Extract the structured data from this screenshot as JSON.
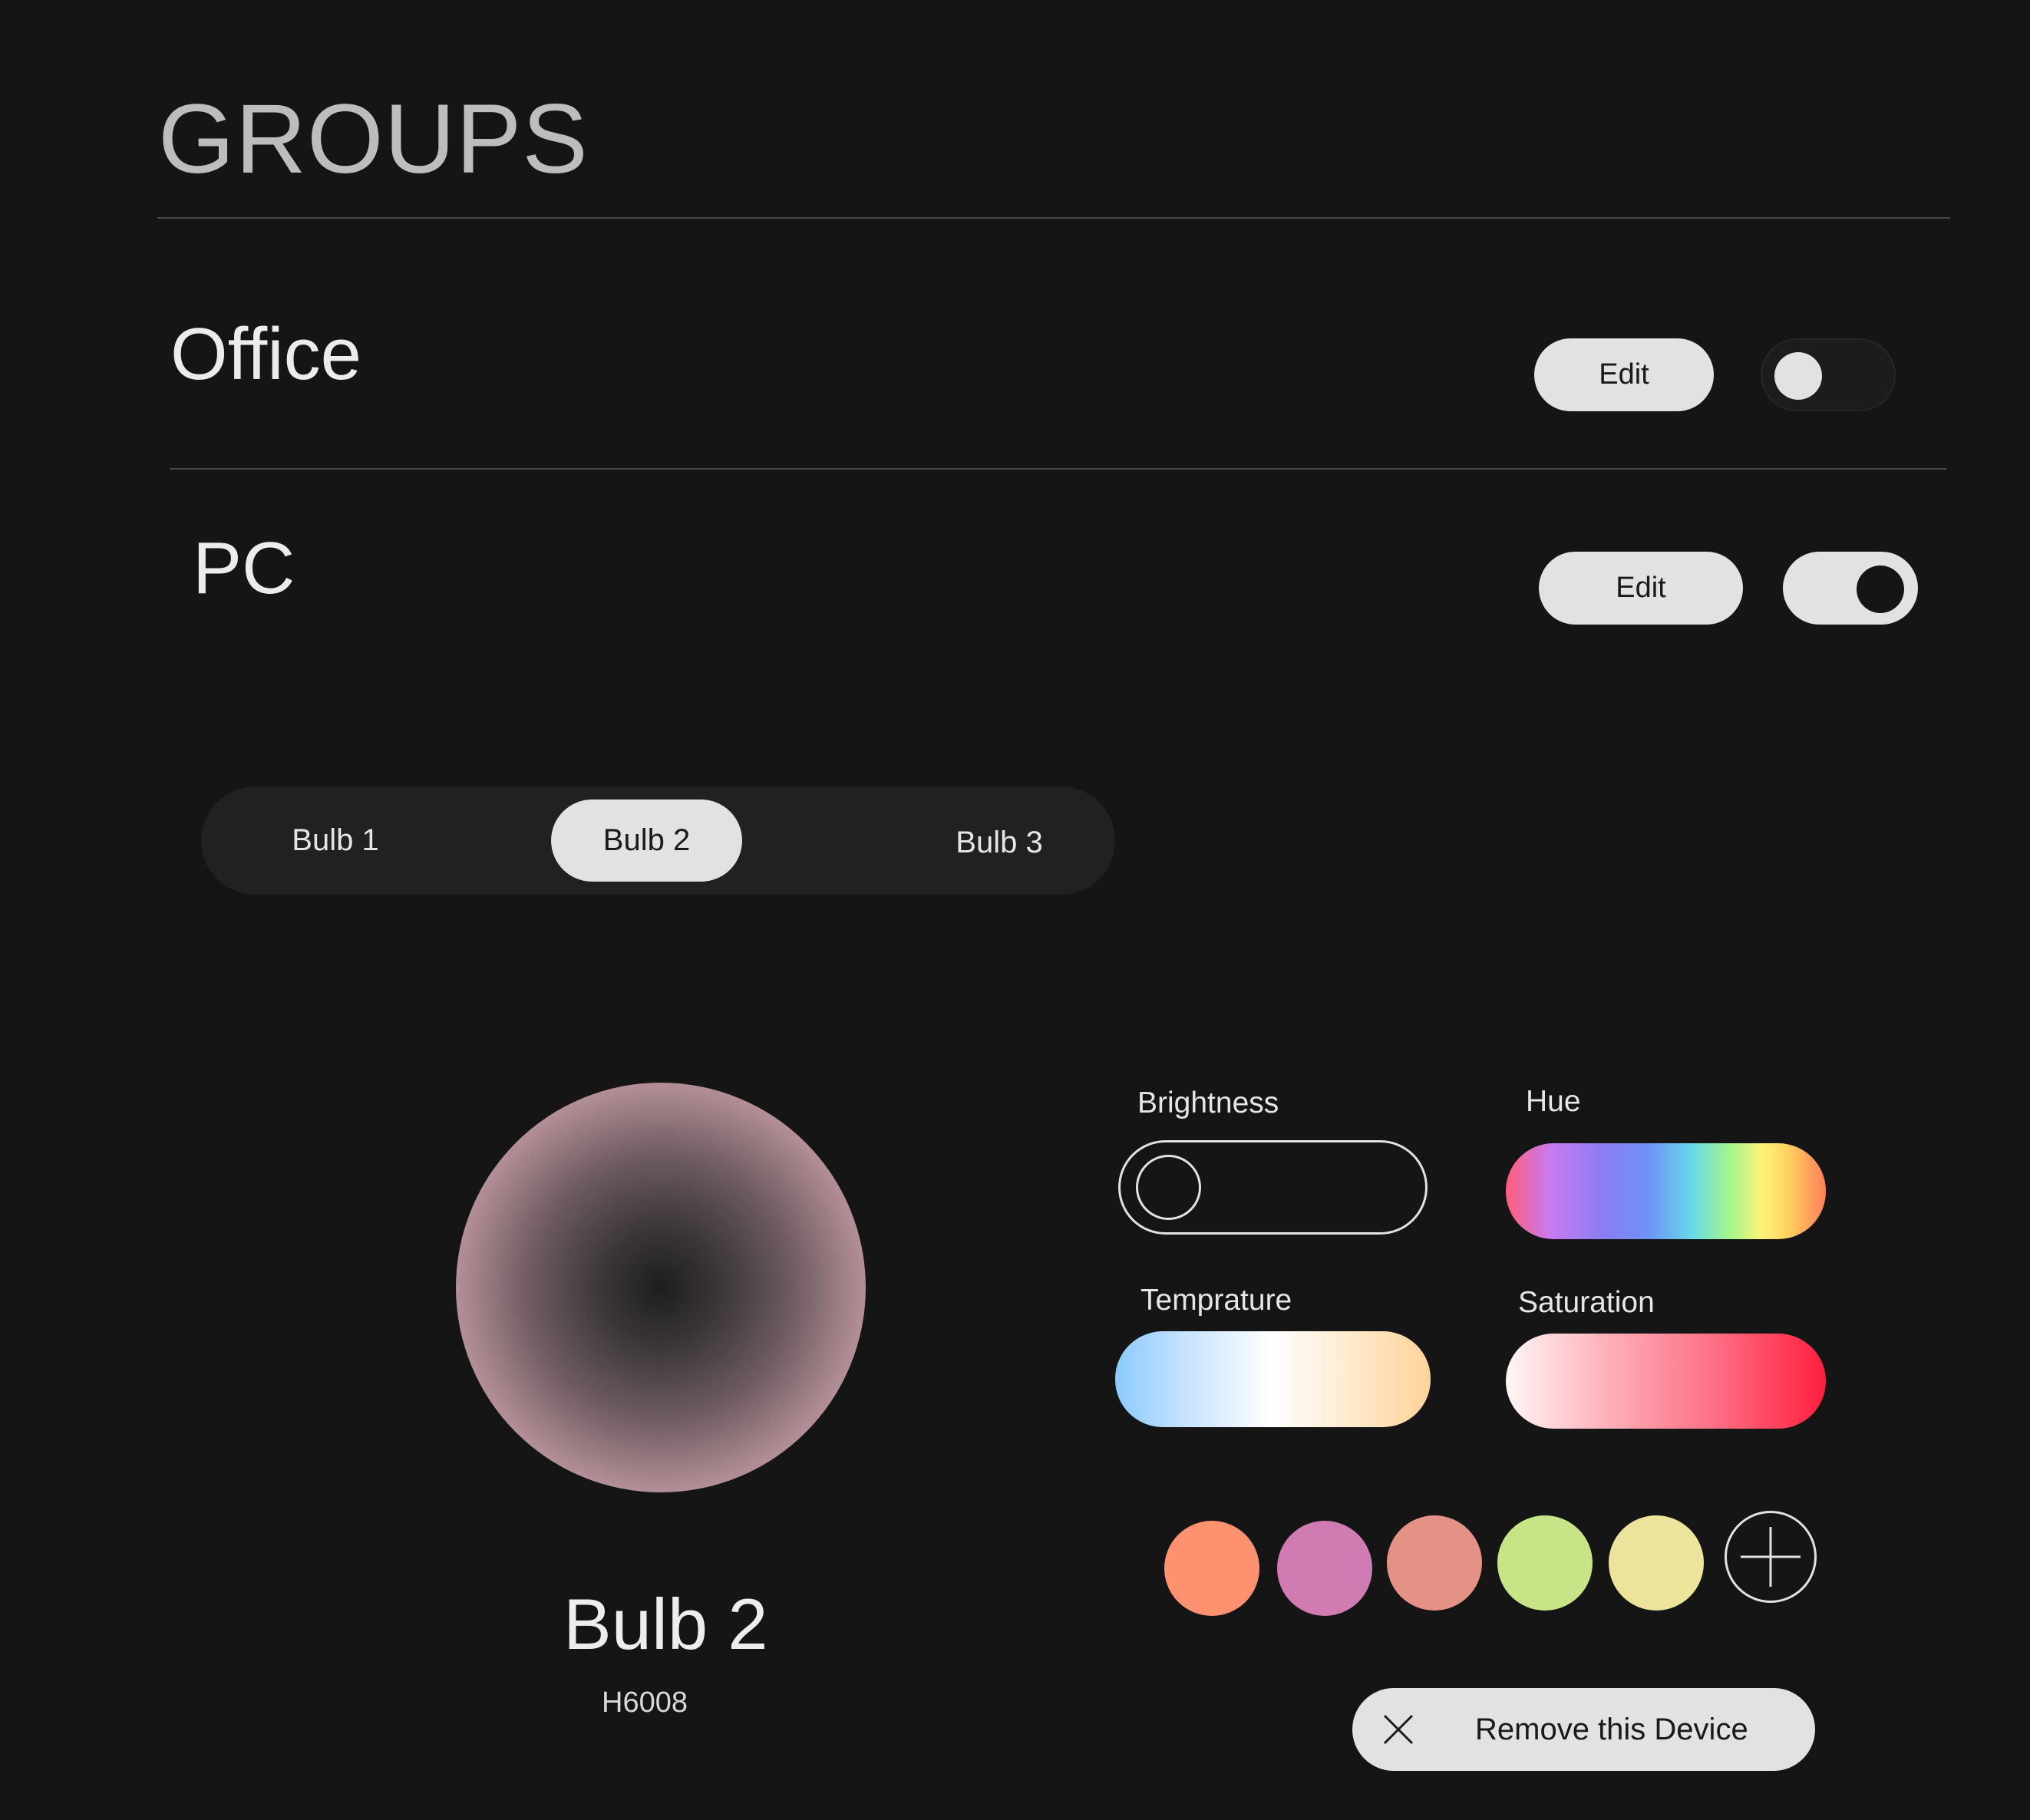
{
  "page": {
    "title": "GROUPS"
  },
  "groups": [
    {
      "name": "Office",
      "edit_label": "Edit",
      "toggle_on": false
    },
    {
      "name": "PC",
      "edit_label": "Edit",
      "toggle_on": true
    }
  ],
  "bulb_tabs": {
    "items": [
      "Bulb 1",
      "Bulb 2",
      "Bulb 3"
    ],
    "selected": "Bulb 2"
  },
  "device": {
    "name": "Bulb 2",
    "model": "H6008",
    "glow_color": "#f5c0c7"
  },
  "controls": {
    "brightness": {
      "label": "Brightness",
      "level": 0
    },
    "hue": {
      "label": "Hue"
    },
    "temperature": {
      "label": "Temprature"
    },
    "saturation": {
      "label": "Saturation"
    }
  },
  "swatches": {
    "colors": [
      "#fe916f",
      "#d07bb2",
      "#e49286",
      "#c7e486",
      "#ebe49a"
    ],
    "add_icon": "plus-icon"
  },
  "remove": {
    "label": "Remove this Device",
    "icon": "close-icon"
  }
}
